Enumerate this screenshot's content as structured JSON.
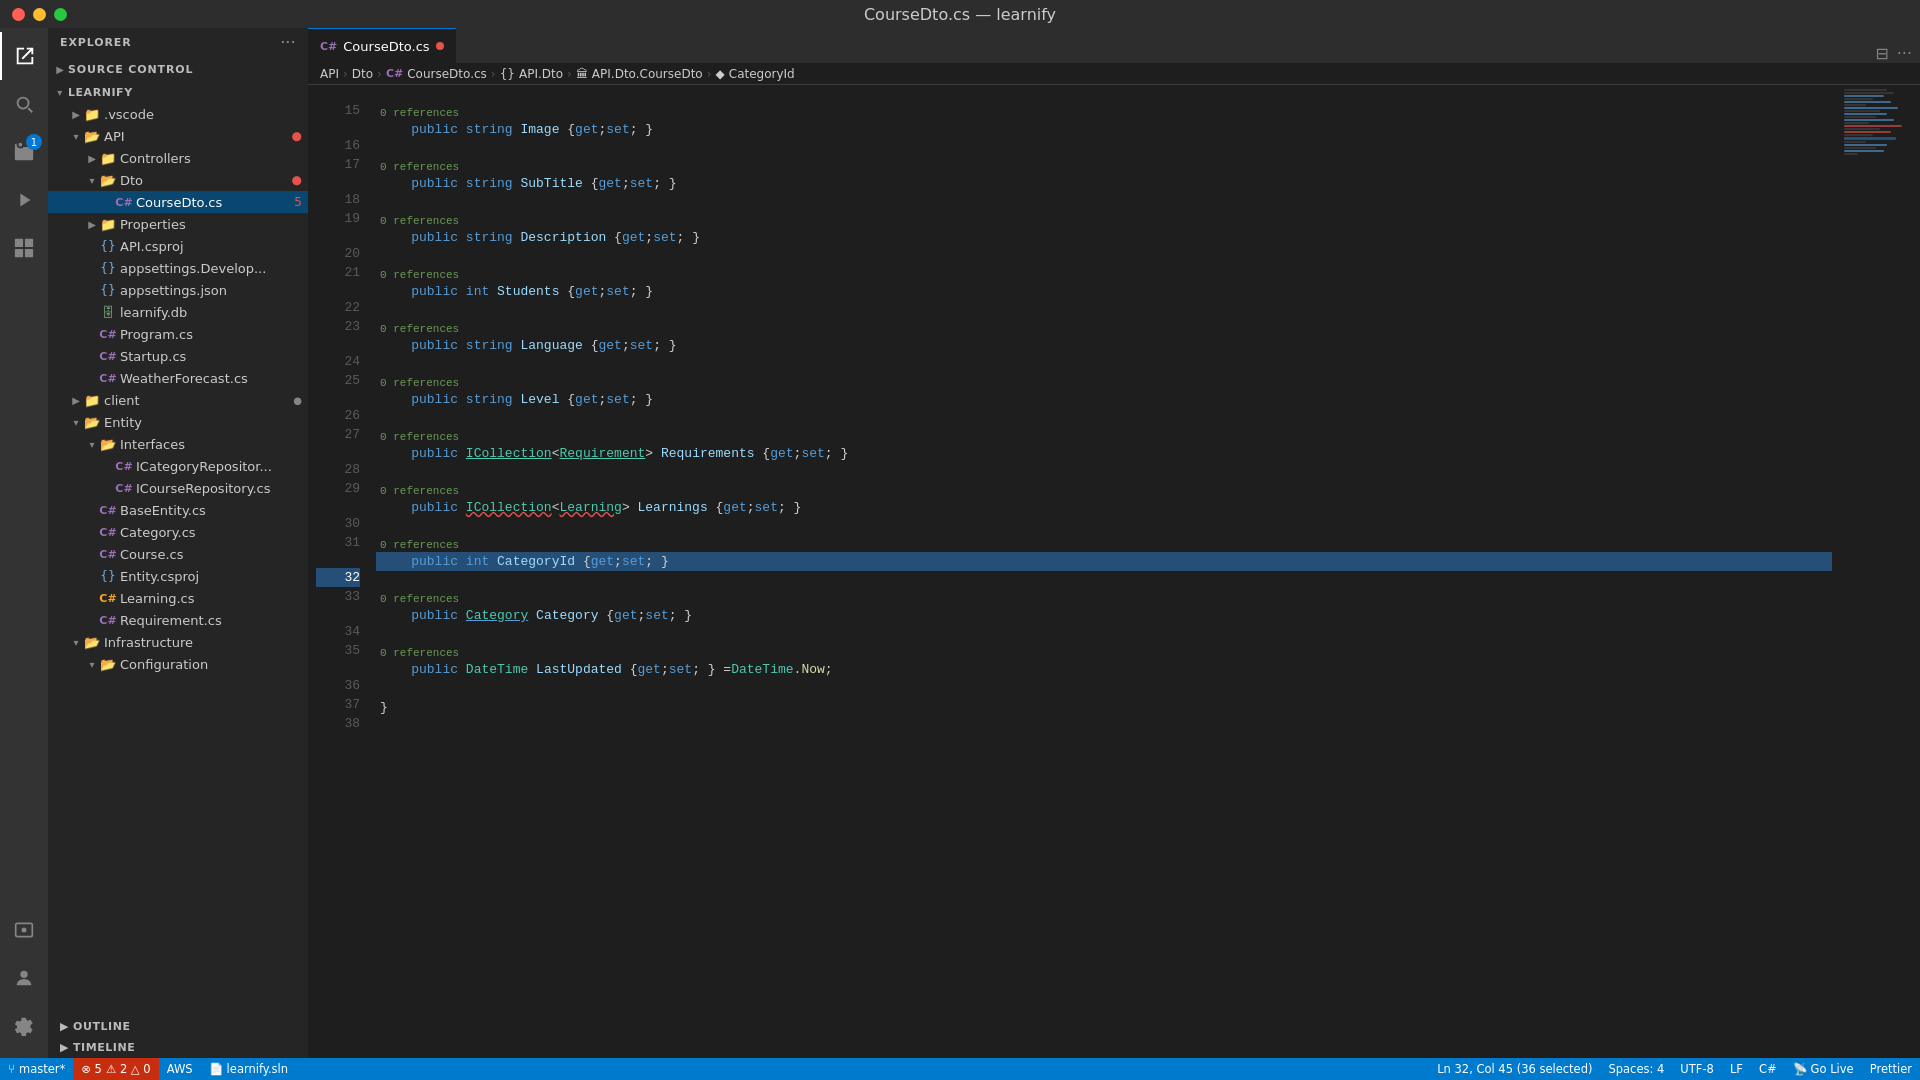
{
  "titlebar": {
    "title": "CourseDto.cs — learnify"
  },
  "activity_bar": {
    "icons": [
      {
        "name": "explorer-icon",
        "symbol": "⎘",
        "active": true,
        "badge": null
      },
      {
        "name": "search-icon",
        "symbol": "🔍",
        "active": false,
        "badge": null
      },
      {
        "name": "source-control-icon",
        "symbol": "⑂",
        "active": false,
        "badge": "1"
      },
      {
        "name": "run-icon",
        "symbol": "▷",
        "active": false,
        "badge": null
      },
      {
        "name": "extensions-icon",
        "symbol": "⊞",
        "active": false,
        "badge": null
      }
    ],
    "bottom_icons": [
      {
        "name": "remote-icon",
        "symbol": "⌨",
        "active": false
      },
      {
        "name": "account-icon",
        "symbol": "👤",
        "active": false
      },
      {
        "name": "settings-icon",
        "symbol": "⚙",
        "active": false
      }
    ]
  },
  "sidebar": {
    "title": "EXPLORER",
    "source_control_label": "SOURCE CONTROL",
    "tree": [
      {
        "id": "learnify-root",
        "label": "LEARNIFY",
        "indent": 0,
        "arrow": "▾",
        "icon": "",
        "type": "root",
        "badge": ""
      },
      {
        "id": "vscode",
        "label": ".vscode",
        "indent": 1,
        "arrow": "▶",
        "icon": "📁",
        "type": "folder"
      },
      {
        "id": "api",
        "label": "API",
        "indent": 1,
        "arrow": "▾",
        "icon": "📂",
        "type": "folder-open",
        "badge": "●"
      },
      {
        "id": "controllers",
        "label": "Controllers",
        "indent": 2,
        "arrow": "▶",
        "icon": "📁",
        "type": "folder"
      },
      {
        "id": "dto",
        "label": "Dto",
        "indent": 2,
        "arrow": "▾",
        "icon": "📂",
        "type": "folder-open",
        "badge": "●"
      },
      {
        "id": "coursedto",
        "label": "CourseDto.cs",
        "indent": 3,
        "arrow": "",
        "icon": "C#",
        "type": "cs",
        "badge": "5",
        "selected": true
      },
      {
        "id": "properties",
        "label": "Properties",
        "indent": 2,
        "arrow": "▶",
        "icon": "📁",
        "type": "folder"
      },
      {
        "id": "apicsproj",
        "label": "API.csproj",
        "indent": 2,
        "arrow": "",
        "icon": "{}",
        "type": "proj"
      },
      {
        "id": "appsettings-dev",
        "label": "appsettings.Develop...",
        "indent": 2,
        "arrow": "",
        "icon": "{}",
        "type": "json"
      },
      {
        "id": "appsettings-json",
        "label": "appsettings.json",
        "indent": 2,
        "arrow": "",
        "icon": "{}",
        "type": "json"
      },
      {
        "id": "learnify-db",
        "label": "learnify.db",
        "indent": 2,
        "arrow": "",
        "icon": "🗄",
        "type": "db"
      },
      {
        "id": "program-cs",
        "label": "Program.cs",
        "indent": 2,
        "arrow": "",
        "icon": "C#",
        "type": "cs"
      },
      {
        "id": "startup-cs",
        "label": "Startup.cs",
        "indent": 2,
        "arrow": "",
        "icon": "C#",
        "type": "cs"
      },
      {
        "id": "weatherforecast-cs",
        "label": "WeatherForecast.cs",
        "indent": 2,
        "arrow": "",
        "icon": "C#",
        "type": "cs"
      },
      {
        "id": "client",
        "label": "client",
        "indent": 1,
        "arrow": "▶",
        "icon": "📁",
        "type": "folder",
        "badge": "●"
      },
      {
        "id": "entity",
        "label": "Entity",
        "indent": 1,
        "arrow": "▾",
        "icon": "📂",
        "type": "folder-open"
      },
      {
        "id": "interfaces",
        "label": "Interfaces",
        "indent": 2,
        "arrow": "▾",
        "icon": "📂",
        "type": "folder-open"
      },
      {
        "id": "icategoryrepo",
        "label": "ICategoryRepositor...",
        "indent": 3,
        "arrow": "",
        "icon": "C#",
        "type": "cs"
      },
      {
        "id": "icourserepo",
        "label": "ICourseRepository.cs",
        "indent": 3,
        "arrow": "",
        "icon": "C#",
        "type": "cs"
      },
      {
        "id": "baseentity",
        "label": "BaseEntity.cs",
        "indent": 2,
        "arrow": "",
        "icon": "C#",
        "type": "cs"
      },
      {
        "id": "category-cs",
        "label": "Category.cs",
        "indent": 2,
        "arrow": "",
        "icon": "C#",
        "type": "cs"
      },
      {
        "id": "course-cs",
        "label": "Course.cs",
        "indent": 2,
        "arrow": "",
        "icon": "C#",
        "type": "cs"
      },
      {
        "id": "entity-csproj",
        "label": "Entity.csproj",
        "indent": 2,
        "arrow": "",
        "icon": "{}",
        "type": "proj"
      },
      {
        "id": "learning-cs",
        "label": "Learning.cs",
        "indent": 2,
        "arrow": "",
        "icon": "C#",
        "type": "cs"
      },
      {
        "id": "requirement-cs",
        "label": "Requirement.cs",
        "indent": 2,
        "arrow": "",
        "icon": "C#",
        "type": "cs"
      },
      {
        "id": "infrastructure",
        "label": "Infrastructure",
        "indent": 1,
        "arrow": "▾",
        "icon": "📂",
        "type": "folder-open"
      },
      {
        "id": "configuration",
        "label": "Configuration",
        "indent": 2,
        "arrow": "▾",
        "icon": "📂",
        "type": "folder-open"
      }
    ],
    "outline_label": "OUTLINE",
    "timeline_label": "TIMELINE"
  },
  "tab_bar": {
    "tabs": [
      {
        "id": "coursedto-tab",
        "label": "CourseDto.cs",
        "active": true,
        "icon": "C#",
        "modified": true
      }
    ],
    "split_icon": "⊟",
    "more_icon": "…"
  },
  "breadcrumb": {
    "items": [
      {
        "label": "API",
        "icon": ""
      },
      {
        "label": "Dto",
        "icon": ""
      },
      {
        "label": "C#",
        "icon": "icon"
      },
      {
        "label": "CourseDto.cs",
        "icon": ""
      },
      {
        "label": "{}",
        "icon": ""
      },
      {
        "label": "API.Dto",
        "icon": ""
      },
      {
        "label": "API.Dto.CourseDto",
        "icon": "🏛"
      },
      {
        "label": "CategoryId",
        "icon": "◆"
      }
    ]
  },
  "code": {
    "lines": [
      {
        "num": 15,
        "hint": "",
        "content": ""
      },
      {
        "num": 16,
        "hint": "0 references",
        "content": "public_string_Image"
      },
      {
        "num": 17,
        "hint": "",
        "content": ""
      },
      {
        "num": 18,
        "hint": "0 references",
        "content": "public_string_SubTitle"
      },
      {
        "num": 19,
        "hint": "",
        "content": ""
      },
      {
        "num": 20,
        "hint": "0 references",
        "content": "public_string_Description"
      },
      {
        "num": 21,
        "hint": "",
        "content": ""
      },
      {
        "num": 22,
        "hint": "0 references",
        "content": "public_int_Students"
      },
      {
        "num": 23,
        "hint": "",
        "content": ""
      },
      {
        "num": 24,
        "hint": "0 references",
        "content": "public_string_Language"
      },
      {
        "num": 25,
        "hint": "",
        "content": ""
      },
      {
        "num": 26,
        "hint": "0 references",
        "content": "public_string_Level"
      },
      {
        "num": 27,
        "hint": "",
        "content": ""
      },
      {
        "num": 28,
        "hint": "0 references",
        "content": "public_ICollection_Requirement_Requirements"
      },
      {
        "num": 29,
        "hint": "",
        "content": ""
      },
      {
        "num": 30,
        "hint": "0 references",
        "content": "public_ICollection_Learning_Learnings"
      },
      {
        "num": 31,
        "hint": "",
        "content": ""
      },
      {
        "num": 32,
        "hint": "0 references",
        "content": "public_int_CategoryId_highlighted",
        "selected": true
      },
      {
        "num": 33,
        "hint": "",
        "content": ""
      },
      {
        "num": 34,
        "hint": "0 references",
        "content": "public_Category_Category"
      },
      {
        "num": 35,
        "hint": "",
        "content": ""
      },
      {
        "num": 36,
        "hint": "0 references",
        "content": "public_DateTime_LastUpdated"
      },
      {
        "num": 37,
        "hint": "",
        "content": ""
      },
      {
        "num": 38,
        "hint": "",
        "content": "closing_brace"
      }
    ]
  },
  "status_bar": {
    "branch": "master*",
    "errors": "⊗ 5",
    "warnings": "⚠ 2  △ 0",
    "aws": "AWS",
    "solution": "learnify.sln",
    "position": "Ln 32, Col 45 (36 selected)",
    "spaces": "Spaces: 4",
    "encoding": "UTF-8",
    "line_ending": "LF",
    "language": "C#",
    "go_live": "Go Live",
    "prettier": "Prettier"
  }
}
